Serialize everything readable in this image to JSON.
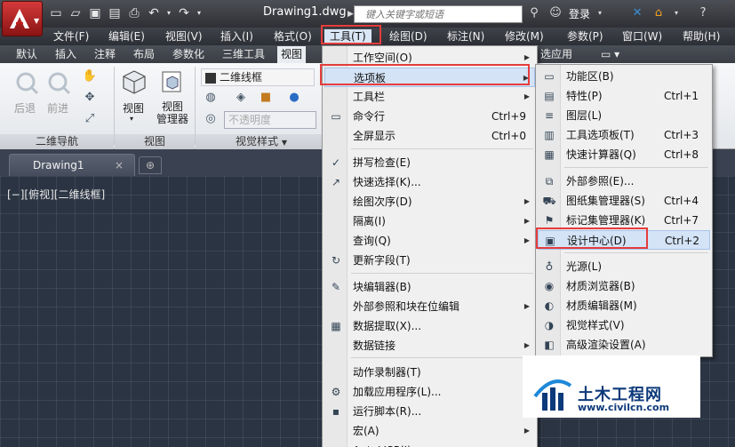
{
  "window": {
    "doc_title": "Drawing1.dwg",
    "search_placeholder": "键入关键字或短语",
    "login_label": "登录"
  },
  "menubar": [
    {
      "label": "文件(F)"
    },
    {
      "label": "编辑(E)"
    },
    {
      "label": "视图(V)"
    },
    {
      "label": "插入(I)"
    },
    {
      "label": "格式(O)"
    },
    {
      "label": "工具(T)"
    },
    {
      "label": "绘图(D)"
    },
    {
      "label": "标注(N)"
    },
    {
      "label": "修改(M)"
    },
    {
      "label": "参数(P)"
    },
    {
      "label": "窗口(W)"
    },
    {
      "label": "帮助(H)"
    }
  ],
  "ribbon_tabs": [
    "默认",
    "插入",
    "注释",
    "布局",
    "参数化",
    "三维工具",
    "视图",
    "选应用"
  ],
  "ribbon": {
    "back_label": "后退",
    "forward_label": "前进",
    "view_label": "视图",
    "view_manager_label": "视图\n管理器",
    "visual_style_combo": "二维线框",
    "opacity_combo": "不透明度",
    "panel_nav": "二维导航",
    "panel_view": "视图",
    "panel_visual_style": "视觉样式"
  },
  "doc_tab": {
    "label": "Drawing1",
    "close": "×"
  },
  "viewport_label": "[−][俯视][二维线框]",
  "tools_menu": [
    {
      "label": "工作空间(O)",
      "shortcut": "",
      "submenu": true
    },
    {
      "label": "选项板",
      "shortcut": "",
      "submenu": true,
      "highlight": true
    },
    {
      "label": "工具栏",
      "shortcut": "",
      "submenu": true
    },
    {
      "label": "命令行",
      "shortcut": "Ctrl+9"
    },
    {
      "label": "全屏显示",
      "shortcut": "Ctrl+0"
    },
    {
      "label": "拼写检查(E)",
      "shortcut": ""
    },
    {
      "label": "快速选择(K)...",
      "shortcut": ""
    },
    {
      "label": "绘图次序(D)",
      "shortcut": "",
      "submenu": true
    },
    {
      "label": "隔离(I)",
      "shortcut": "",
      "submenu": true
    },
    {
      "label": "查询(Q)",
      "shortcut": "",
      "submenu": true
    },
    {
      "label": "更新字段(T)",
      "shortcut": ""
    },
    {
      "label": "块编辑器(B)",
      "shortcut": ""
    },
    {
      "label": "外部参照和块在位编辑",
      "shortcut": "",
      "submenu": true
    },
    {
      "label": "数据提取(X)...",
      "shortcut": ""
    },
    {
      "label": "数据链接",
      "shortcut": "",
      "submenu": true
    },
    {
      "label": "动作录制器(T)",
      "shortcut": "",
      "submenu": true
    },
    {
      "label": "加载应用程序(L)...",
      "shortcut": ""
    },
    {
      "label": "运行脚本(R)...",
      "shortcut": ""
    },
    {
      "label": "宏(A)",
      "shortcut": "",
      "submenu": true
    },
    {
      "label": "AutoLISP(I)",
      "shortcut": "",
      "submenu": true
    }
  ],
  "palettes_menu": [
    {
      "label": "功能区(B)",
      "shortcut": ""
    },
    {
      "label": "特性(P)",
      "shortcut": "Ctrl+1"
    },
    {
      "label": "图层(L)",
      "shortcut": ""
    },
    {
      "label": "工具选项板(T)",
      "shortcut": "Ctrl+3"
    },
    {
      "label": "快速计算器(Q)",
      "shortcut": "Ctrl+8"
    },
    {
      "label": "外部参照(E)...",
      "shortcut": ""
    },
    {
      "label": "图纸集管理器(S)",
      "shortcut": "Ctrl+4"
    },
    {
      "label": "标记集管理器(K)",
      "shortcut": "Ctrl+7"
    },
    {
      "label": "设计中心(D)",
      "shortcut": "Ctrl+2",
      "highlight": true
    },
    {
      "label": "光源(L)",
      "shortcut": ""
    },
    {
      "label": "材质浏览器(B)",
      "shortcut": ""
    },
    {
      "label": "材质编辑器(M)",
      "shortcut": ""
    },
    {
      "label": "视觉样式(V)",
      "shortcut": ""
    },
    {
      "label": "高级渲染设置(A)",
      "shortcut": ""
    }
  ],
  "watermark": {
    "brand": "土木工程网",
    "url": "www.civilcn.com"
  }
}
